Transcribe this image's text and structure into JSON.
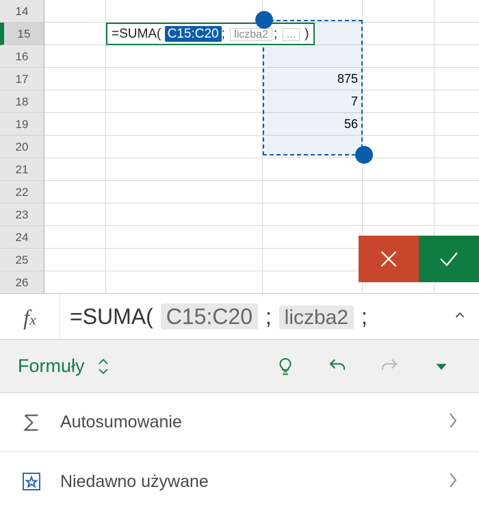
{
  "rows": [
    "14",
    "15",
    "16",
    "17",
    "18",
    "19",
    "20",
    "21",
    "22",
    "23",
    "24",
    "25",
    "26"
  ],
  "activeRow": "15",
  "cellFormula": {
    "prefix": "=SUMA(",
    "range": "C15:C20",
    "hint1": "liczba2",
    "hint2": "...",
    "suffix": ")"
  },
  "cellValues": {
    "c17": "875",
    "c18": "7",
    "c19": "56"
  },
  "formulaBar": {
    "prefix": "=SUMA(",
    "token1": "C15:C20",
    "sep": ";",
    "token2": "liczba2",
    "sepEnd": ";"
  },
  "ribbon": {
    "tab": "Formuły"
  },
  "menu": {
    "autosum": "Autosumowanie",
    "recent": "Niedawno używane"
  }
}
